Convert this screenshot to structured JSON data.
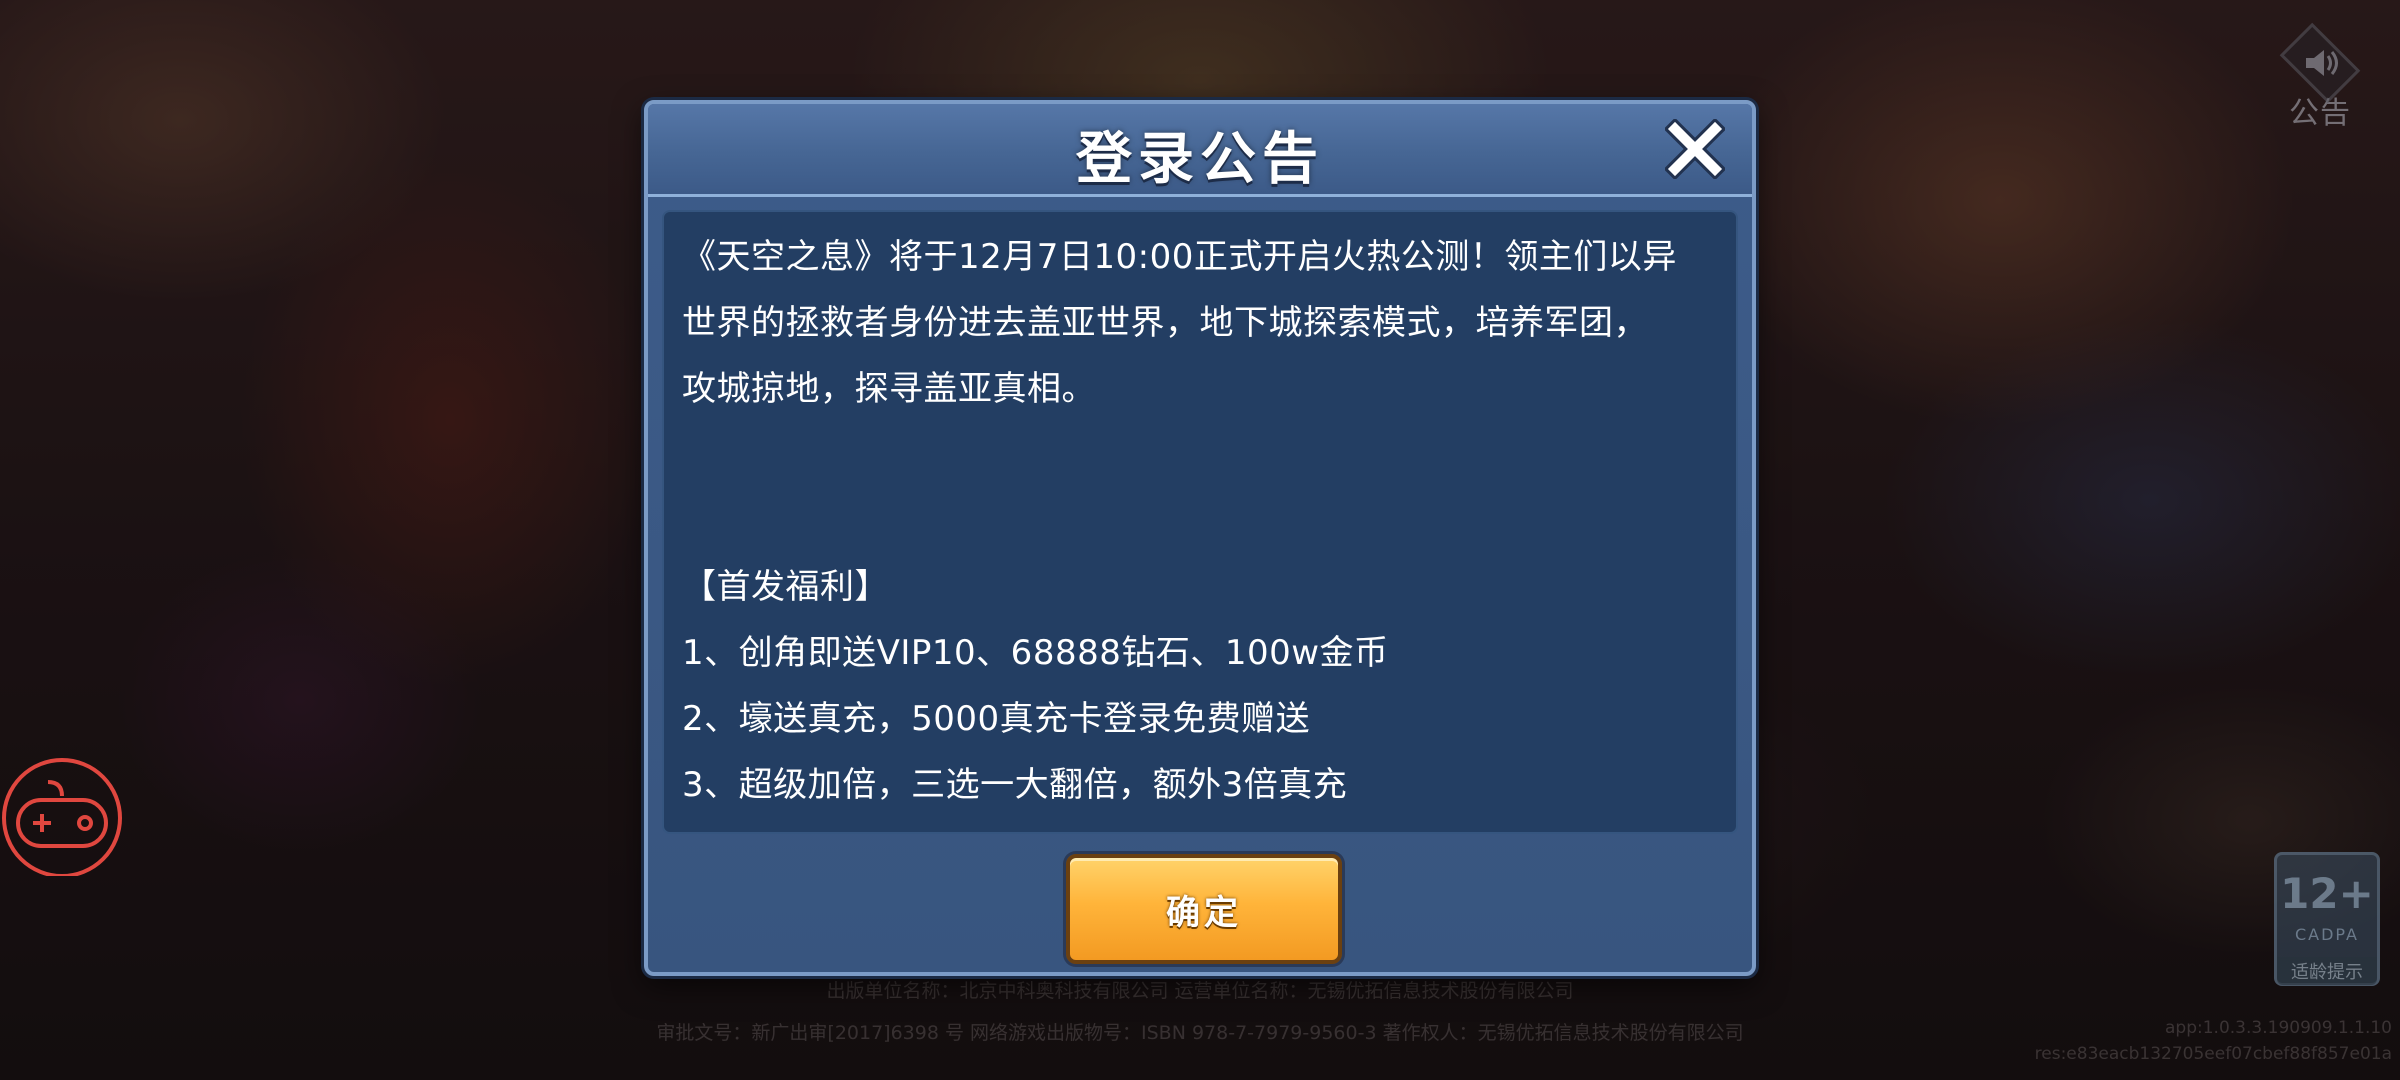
{
  "dialog": {
    "title": "登录公告",
    "close_icon": "close-icon",
    "paragraphs": [
      "《天空之息》将于12月7日10:00正式开启火热公测！领主们以异",
      "世界的拯救者身份进去盖亚世界，地下城探索模式，培养军团，",
      "攻城掠地，探寻盖亚真相。"
    ],
    "benefits_heading": "【首发福利】",
    "benefits": [
      "1、创角即送VIP10、68888钻石、100w金币",
      "2、壕送真充，5000真充卡登录免费赠送",
      "3、超级加倍，三选一大翻倍，额外3倍真充"
    ],
    "confirm_label": "确定"
  },
  "notice_button": {
    "icon": "speaker-icon",
    "label": "公告"
  },
  "gamepad_button": {
    "icon": "gamepad-icon",
    "color": "#e0473f"
  },
  "age_rating": {
    "age": "12+",
    "org": "CADPA",
    "tip": "适龄提示"
  },
  "footer": {
    "line1": "出版单位名称：北京中科奥科技有限公司    运营单位名称：无锡优拓信息技术股份有限公司",
    "line2": "审批文号：新广出审[2017]6398 号    网络游戏出版物号：ISBN 978-7-7979-9560-3    著作权人：无锡优拓信息技术股份有限公司"
  },
  "version": {
    "app": "app:1.0.3.3.190909.1.1.10",
    "res": "res:e83eacb132705eef07cbef88f857e01a"
  },
  "colors": {
    "dialog_border": "#7b9bc6",
    "panel_bg": "#233e63",
    "button_orange": "#ffb43a"
  }
}
